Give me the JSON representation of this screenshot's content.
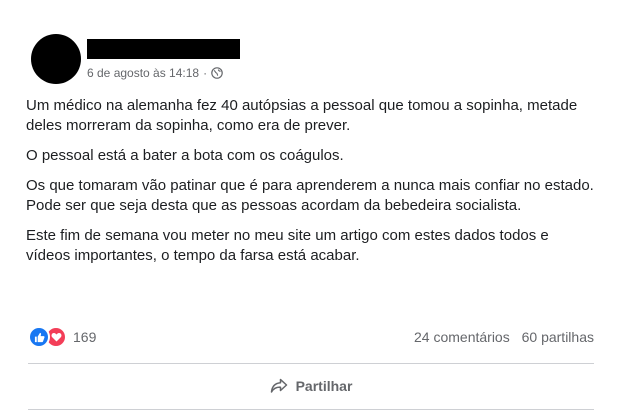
{
  "post": {
    "timestamp": "6 de agosto às 14:18",
    "separator": "·",
    "privacy_icon": "globe-icon",
    "paragraphs": [
      "Um médico na alemanha fez 40 autópsias a pessoal que tomou a sopinha, metade deles morreram da sopinha, como era de prever.",
      "O pessoal está a bater a bota com os coágulos.",
      "Os que tomaram vão patinar que é para aprenderem a nunca mais confiar no estado. Pode ser que seja desta que as pessoas acordam da bebedeira socialista.",
      "Este fim de semana vou meter no meu site um artigo com estes dados todos e vídeos importantes, o tempo da farsa está acabar."
    ]
  },
  "stats": {
    "reaction_icons": [
      "like-icon",
      "love-icon"
    ],
    "reaction_count": "169",
    "comments": "24 comentários",
    "shares": "60 partilhas"
  },
  "actions": {
    "share_label": "Partilhar",
    "share_icon": "share-arrow-icon"
  },
  "colors": {
    "like": "#1877f2",
    "love": "#f33e58",
    "secondary_text": "#65676b"
  }
}
